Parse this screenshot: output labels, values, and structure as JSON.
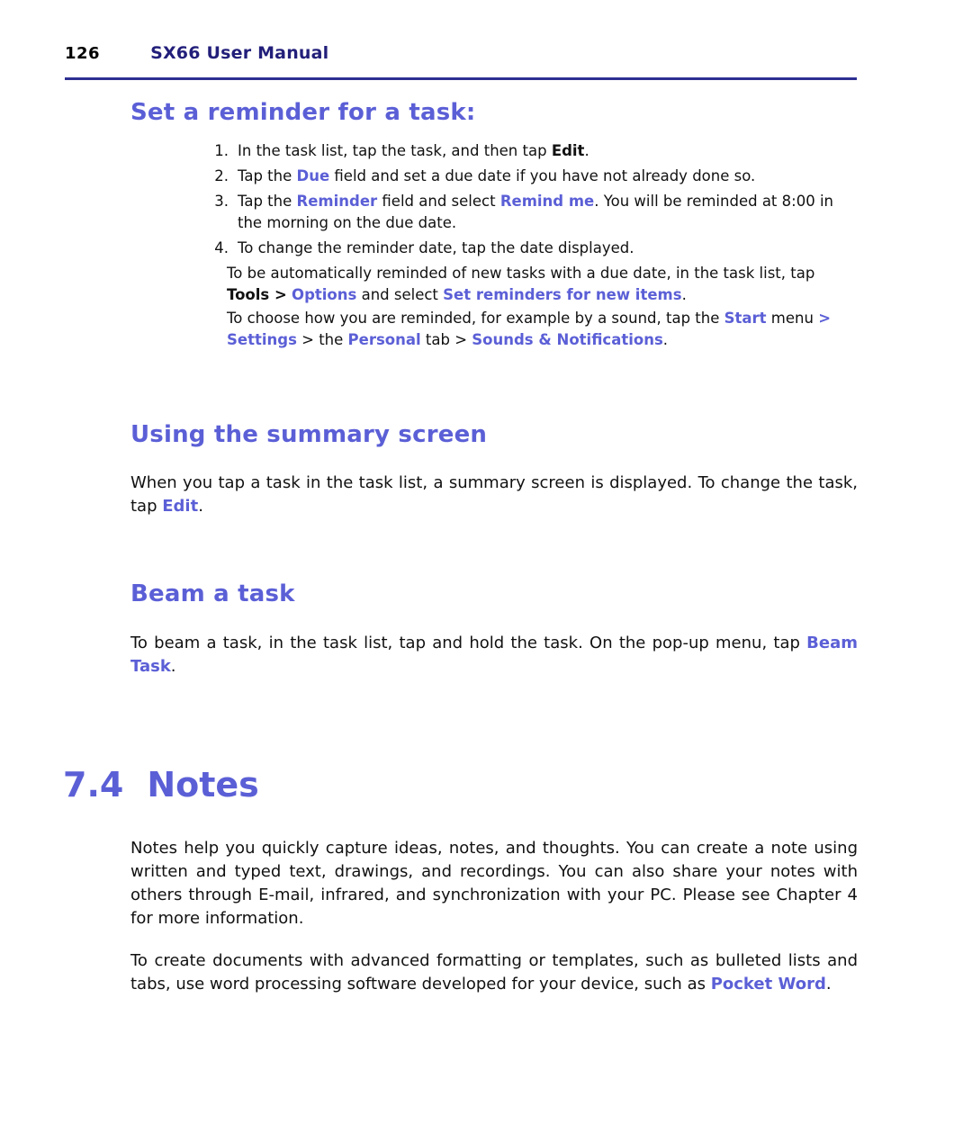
{
  "header": {
    "page_number": "126",
    "manual_title": "SX66 User Manual"
  },
  "sections": {
    "reminder": {
      "heading": "Set a reminder for a task:",
      "steps": [
        {
          "num": "1.",
          "parts": [
            {
              "t": "In the task list, tap the task, and then tap ",
              "s": "normal"
            },
            {
              "t": "Edit",
              "s": "bold"
            },
            {
              "t": ".",
              "s": "normal"
            }
          ]
        },
        {
          "num": "2.",
          "parts": [
            {
              "t": "Tap the ",
              "s": "normal"
            },
            {
              "t": "Due",
              "s": "accent"
            },
            {
              "t": " field and set a due date if you have not already done so.",
              "s": "normal"
            }
          ]
        },
        {
          "num": "3.",
          "parts": [
            {
              "t": "Tap the ",
              "s": "normal"
            },
            {
              "t": "Reminder",
              "s": "accent"
            },
            {
              "t": " field and select ",
              "s": "normal"
            },
            {
              "t": "Remind me",
              "s": "accent"
            },
            {
              "t": ". You will be reminded at 8:00 in the morning on the due date.",
              "s": "normal"
            }
          ]
        },
        {
          "num": "4.",
          "parts": [
            {
              "t": "To change the reminder date, tap the date displayed.",
              "s": "normal"
            }
          ]
        }
      ],
      "note1": [
        {
          "t": "To be automatically reminded of new tasks with a due date, in the task list, tap ",
          "s": "normal"
        },
        {
          "t": "Tools >",
          "s": "bold"
        },
        {
          "t": " ",
          "s": "normal"
        },
        {
          "t": "Options",
          "s": "accent"
        },
        {
          "t": " and select ",
          "s": "normal"
        },
        {
          "t": "Set reminders for new items",
          "s": "accent"
        },
        {
          "t": ".",
          "s": "normal"
        }
      ],
      "note2": [
        {
          "t": "To choose how you are reminded, for example by a sound, tap the ",
          "s": "normal"
        },
        {
          "t": "Start",
          "s": "accent"
        },
        {
          "t": " menu ",
          "s": "normal"
        },
        {
          "t": "> Settings",
          "s": "accent"
        },
        {
          "t": " > the ",
          "s": "normal"
        },
        {
          "t": "Personal",
          "s": "accent"
        },
        {
          "t": " tab > ",
          "s": "normal"
        },
        {
          "t": "Sounds & Notifications",
          "s": "accent"
        },
        {
          "t": ".",
          "s": "normal"
        }
      ]
    },
    "summary": {
      "heading": "Using the summary screen",
      "body": [
        {
          "t": "When you tap a task in the task list, a summary screen is displayed. To change the task, tap ",
          "s": "normal"
        },
        {
          "t": "Edit",
          "s": "accent"
        },
        {
          "t": ".",
          "s": "normal"
        }
      ]
    },
    "beam": {
      "heading": "Beam a task",
      "body": [
        {
          "t": "To beam a task, in the task list, tap and hold the task. On the pop-up menu, tap ",
          "s": "normal"
        },
        {
          "t": "Beam Task",
          "s": "accent"
        },
        {
          "t": ".",
          "s": "normal"
        }
      ]
    },
    "notes": {
      "number": "7.4",
      "title": "Notes",
      "para1": [
        {
          "t": "Notes help you quickly capture ideas, notes, and thoughts. You can create a note using written and typed text, drawings, and recordings. You can also share your notes with others through E-mail, infrared, and synchronization with your PC. Please see Chapter 4 for more information.",
          "s": "normal"
        }
      ],
      "para2": [
        {
          "t": "To create documents with advanced formatting or templates, such as bulleted lists and tabs, use word processing software developed for your device, such as ",
          "s": "normal"
        },
        {
          "t": "Pocket Word",
          "s": "accent"
        },
        {
          "t": ".",
          "s": "normal"
        }
      ]
    }
  },
  "colors": {
    "accent": "#5b5fd6",
    "header_title": "#221f7a",
    "rule": "#2d2f91"
  }
}
